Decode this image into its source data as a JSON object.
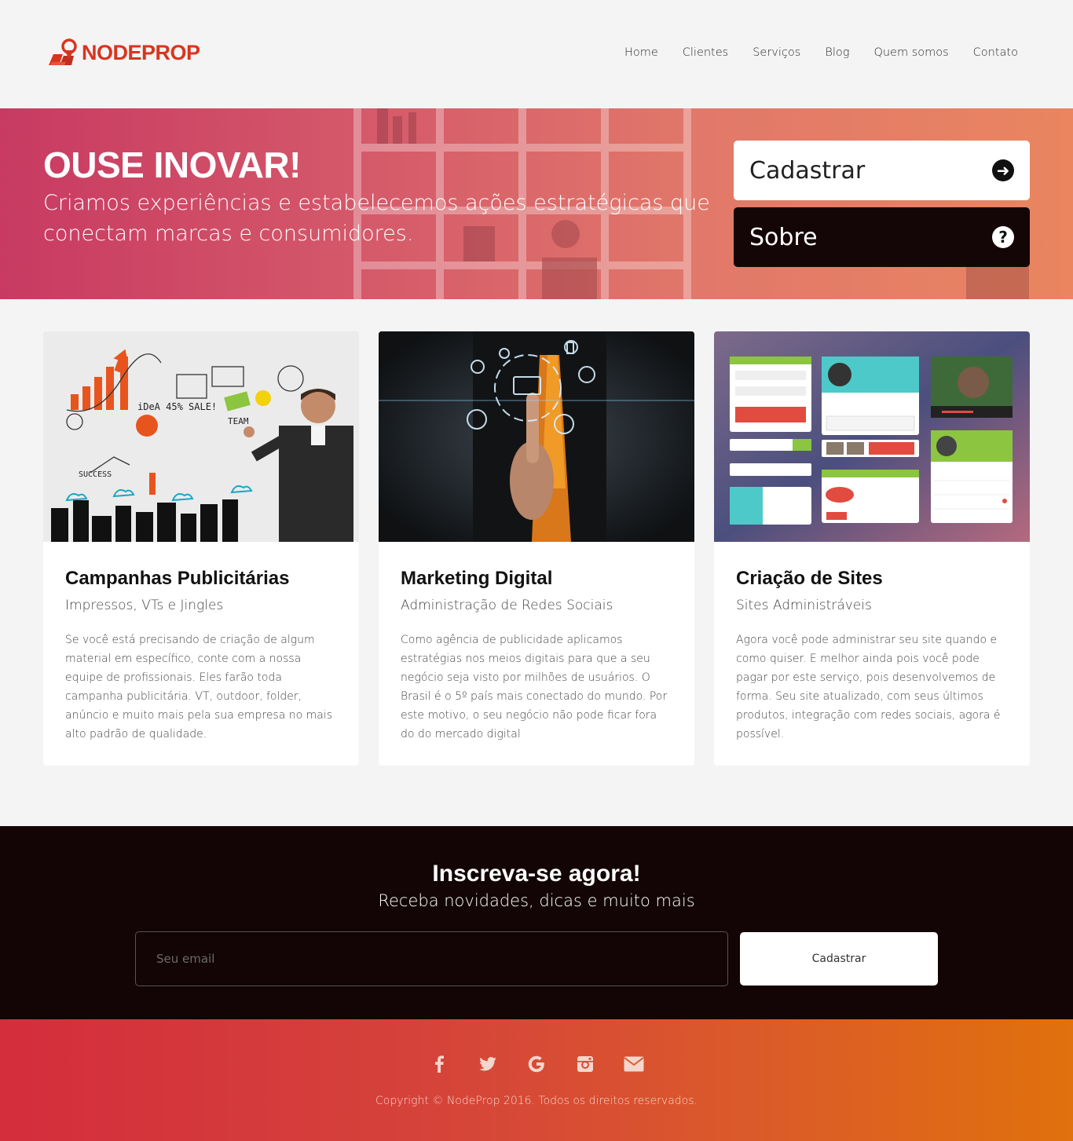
{
  "brand": {
    "name": "NODEPROP",
    "color": "#d8351f"
  },
  "nav": {
    "items": [
      "Home",
      "Clientes",
      "Serviços",
      "Blog",
      "Quem somos",
      "Contato"
    ]
  },
  "hero": {
    "title": "OUSE INOVAR!",
    "subtitle": "Criamos experiências e estabelecemos ações estratégicas que conectam marcas e consumidores.",
    "primary_button": "Cadastrar",
    "secondary_button": "Sobre",
    "primary_icon": "arrow-right-circle-icon",
    "secondary_icon": "question-circle-icon"
  },
  "cards": [
    {
      "title": "Campanhas Publicitárias",
      "subtitle": "Impressos, VTs e Jingles",
      "text": "Se você está precisando de criação de algum material em específico, conte com a nossa equipe de profissionais. Eles farão toda campanha publicitária. VT, outdoor, folder, anúncio e muito mais pela sua empresa no mais alto padrão de qualidade."
    },
    {
      "title": "Marketing Digital",
      "subtitle": "Administração de Redes Sociais",
      "text": "Como agência de publicidade aplicamos estratégias nos meios digitais para que a seu negócio seja visto por milhões de usuários. O Brasil é o 5º país mais conectado do mundo. Por este motivo, o seu negócio não pode ficar fora do do mercado digital"
    },
    {
      "title": "Criação de Sites",
      "subtitle": "Sites Administráveis",
      "text": "Agora você pode administrar seu site quando e como quiser. E melhor ainda pois você pode pagar por este serviço, pois desenvolvemos de forma. Seu site atualizado, com seus últimos produtos, integração com redes sociais, agora é possível."
    }
  ],
  "newsletter": {
    "title": "Inscreva-se agora!",
    "subtitle": "Receba novidades, dicas e muito mais",
    "email_placeholder": "Seu email",
    "button": "Cadastrar"
  },
  "footer": {
    "socials": [
      "facebook-icon",
      "twitter-icon",
      "google-icon",
      "instagram-icon",
      "envelope-icon"
    ],
    "copyright": "Copyright © NodeProp 2016. Todos os direitos reservados."
  },
  "colors": {
    "hero_start": "#c83a62",
    "hero_end": "#ea8560",
    "footer_start": "#d42d3c",
    "footer_end": "#e0710c",
    "dark": "#130405"
  }
}
